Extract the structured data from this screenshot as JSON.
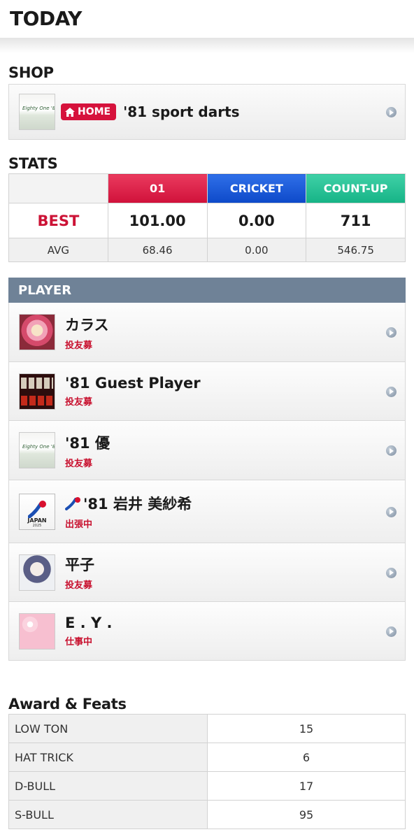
{
  "header": {
    "title": "TODAY"
  },
  "shop": {
    "section_label": "SHOP",
    "badge_label": "HOME",
    "name": "'81 sport darts",
    "thumb_text": "Eighty One '81"
  },
  "stats": {
    "section_label": "STATS",
    "columns": [
      "01",
      "CRICKET",
      "COUNT-UP"
    ],
    "best_label": "BEST",
    "best_values": [
      "101.00",
      "0.00",
      "711"
    ],
    "avg_label": "AVG",
    "avg_values": [
      "68.46",
      "0.00",
      "546.75"
    ],
    "colors": {
      "col01": "#d0113a",
      "cricket": "#0d49c9",
      "countup": "#16b386",
      "best": "#cc1336"
    }
  },
  "player": {
    "section_label": "PLAYER",
    "items": [
      {
        "name": "カラス",
        "status": "投友募",
        "avatar": "anime-girl-avatar"
      },
      {
        "name": "'81 Guest Player",
        "status": "投友募",
        "avatar": "1000-bull-avatar"
      },
      {
        "name": "'81 優",
        "status": "投友募",
        "avatar": "shop-logo-avatar"
      },
      {
        "name": "'81 岩井 美紗希",
        "status": "出張中",
        "avatar": "japan-2025-avatar",
        "japan_text": "JAPAN",
        "japan_year": "2025"
      },
      {
        "name": "平子",
        "status": "投友募",
        "avatar": "anime-girl-avatar"
      },
      {
        "name": "E . Y .",
        "status": "仕事中",
        "avatar": "sakura-avatar"
      }
    ]
  },
  "awards": {
    "section_label": "Award & Feats",
    "rows": [
      {
        "label": "LOW TON",
        "value": "15"
      },
      {
        "label": "HAT TRICK",
        "value": "6"
      },
      {
        "label": "D-BULL",
        "value": "17"
      },
      {
        "label": "S-BULL",
        "value": "95"
      }
    ]
  }
}
